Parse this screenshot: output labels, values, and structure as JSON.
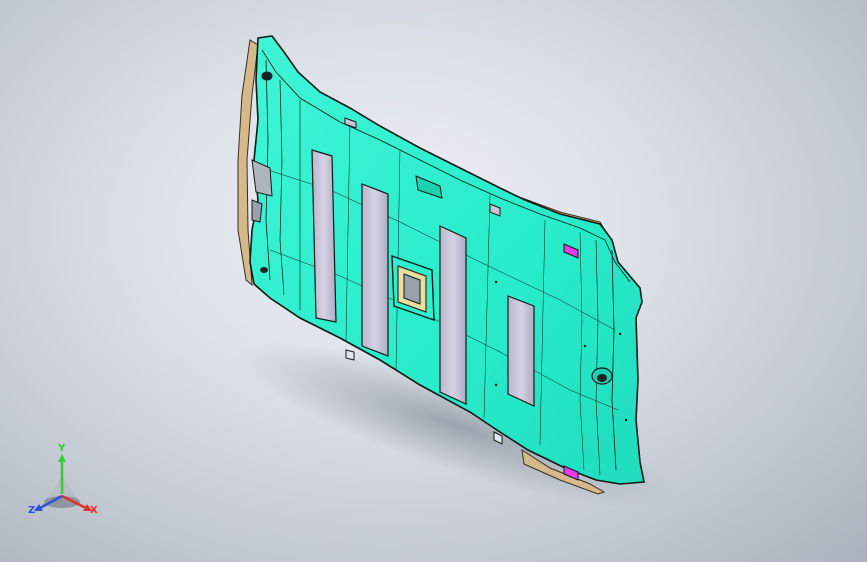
{
  "viewport": {
    "background_top": "#eef1f5",
    "background_bottom": "#aab1bc"
  },
  "model": {
    "part_color": "#2ef0cf",
    "edge_color": "#0d1a1a",
    "insert_color": "#c8c6d8",
    "trim_color": "#d6b98a",
    "clip_color": "#e63be6"
  },
  "triad": {
    "y_label": "Y",
    "x_label": "X",
    "z_label": "Z",
    "y_color": "#33cc33",
    "x_color": "#e03030",
    "z_color": "#3050e0"
  }
}
